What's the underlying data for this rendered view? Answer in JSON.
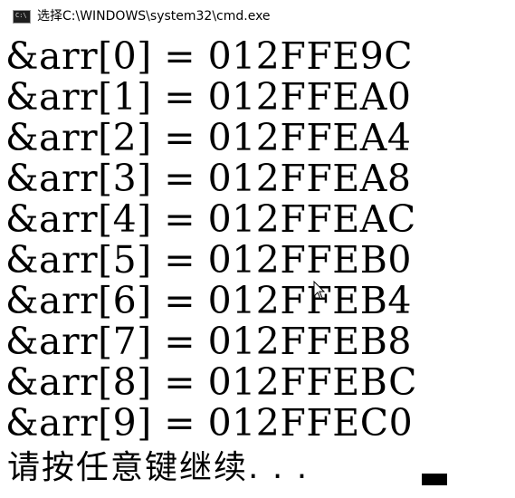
{
  "window": {
    "title": "选择C:\\WINDOWS\\system32\\cmd.exe",
    "icon": "cmd-console-icon"
  },
  "console": {
    "lines": [
      "&arr[0] = 012FFE9C",
      "&arr[1] = 012FFEA0",
      "&arr[2] = 012FFEA4",
      "&arr[3] = 012FFEA8",
      "&arr[4] = 012FFEAC",
      "&arr[5] = 012FFEB0",
      "&arr[6] = 012FFEB4",
      "&arr[7] = 012FFEB8",
      "&arr[8] = 012FFEBC",
      "&arr[9] = 012FFEC0"
    ],
    "prompt": "请按任意键继续. . ."
  },
  "colors": {
    "background": "#ffffff",
    "text": "#000000"
  }
}
